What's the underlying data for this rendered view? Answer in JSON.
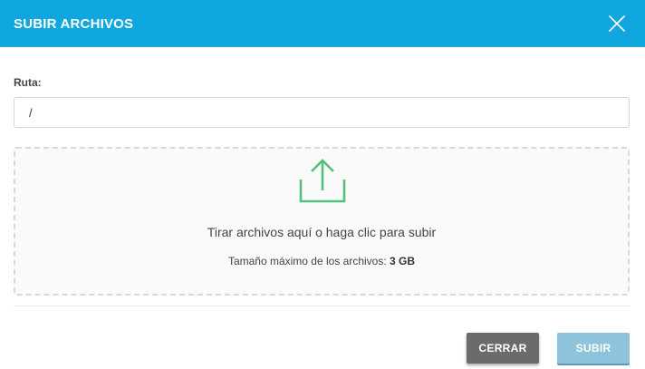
{
  "header": {
    "title": "SUBIR ARCHIVOS"
  },
  "path": {
    "label": "Ruta:",
    "value": "/"
  },
  "dropzone": {
    "text": "Tirar archivos aquí o haga clic para subir",
    "max_size_label": "Tamaño máximo de los archivos:",
    "max_size_value": "3 GB",
    "icon": "upload-icon"
  },
  "footer": {
    "close_label": "CERRAR",
    "upload_label": "SUBIR"
  },
  "colors": {
    "header_bg": "#0fa7dd",
    "icon_green": "#52c27c",
    "close_button": "#6b6b6b",
    "upload_button": "#8fc3dc"
  }
}
